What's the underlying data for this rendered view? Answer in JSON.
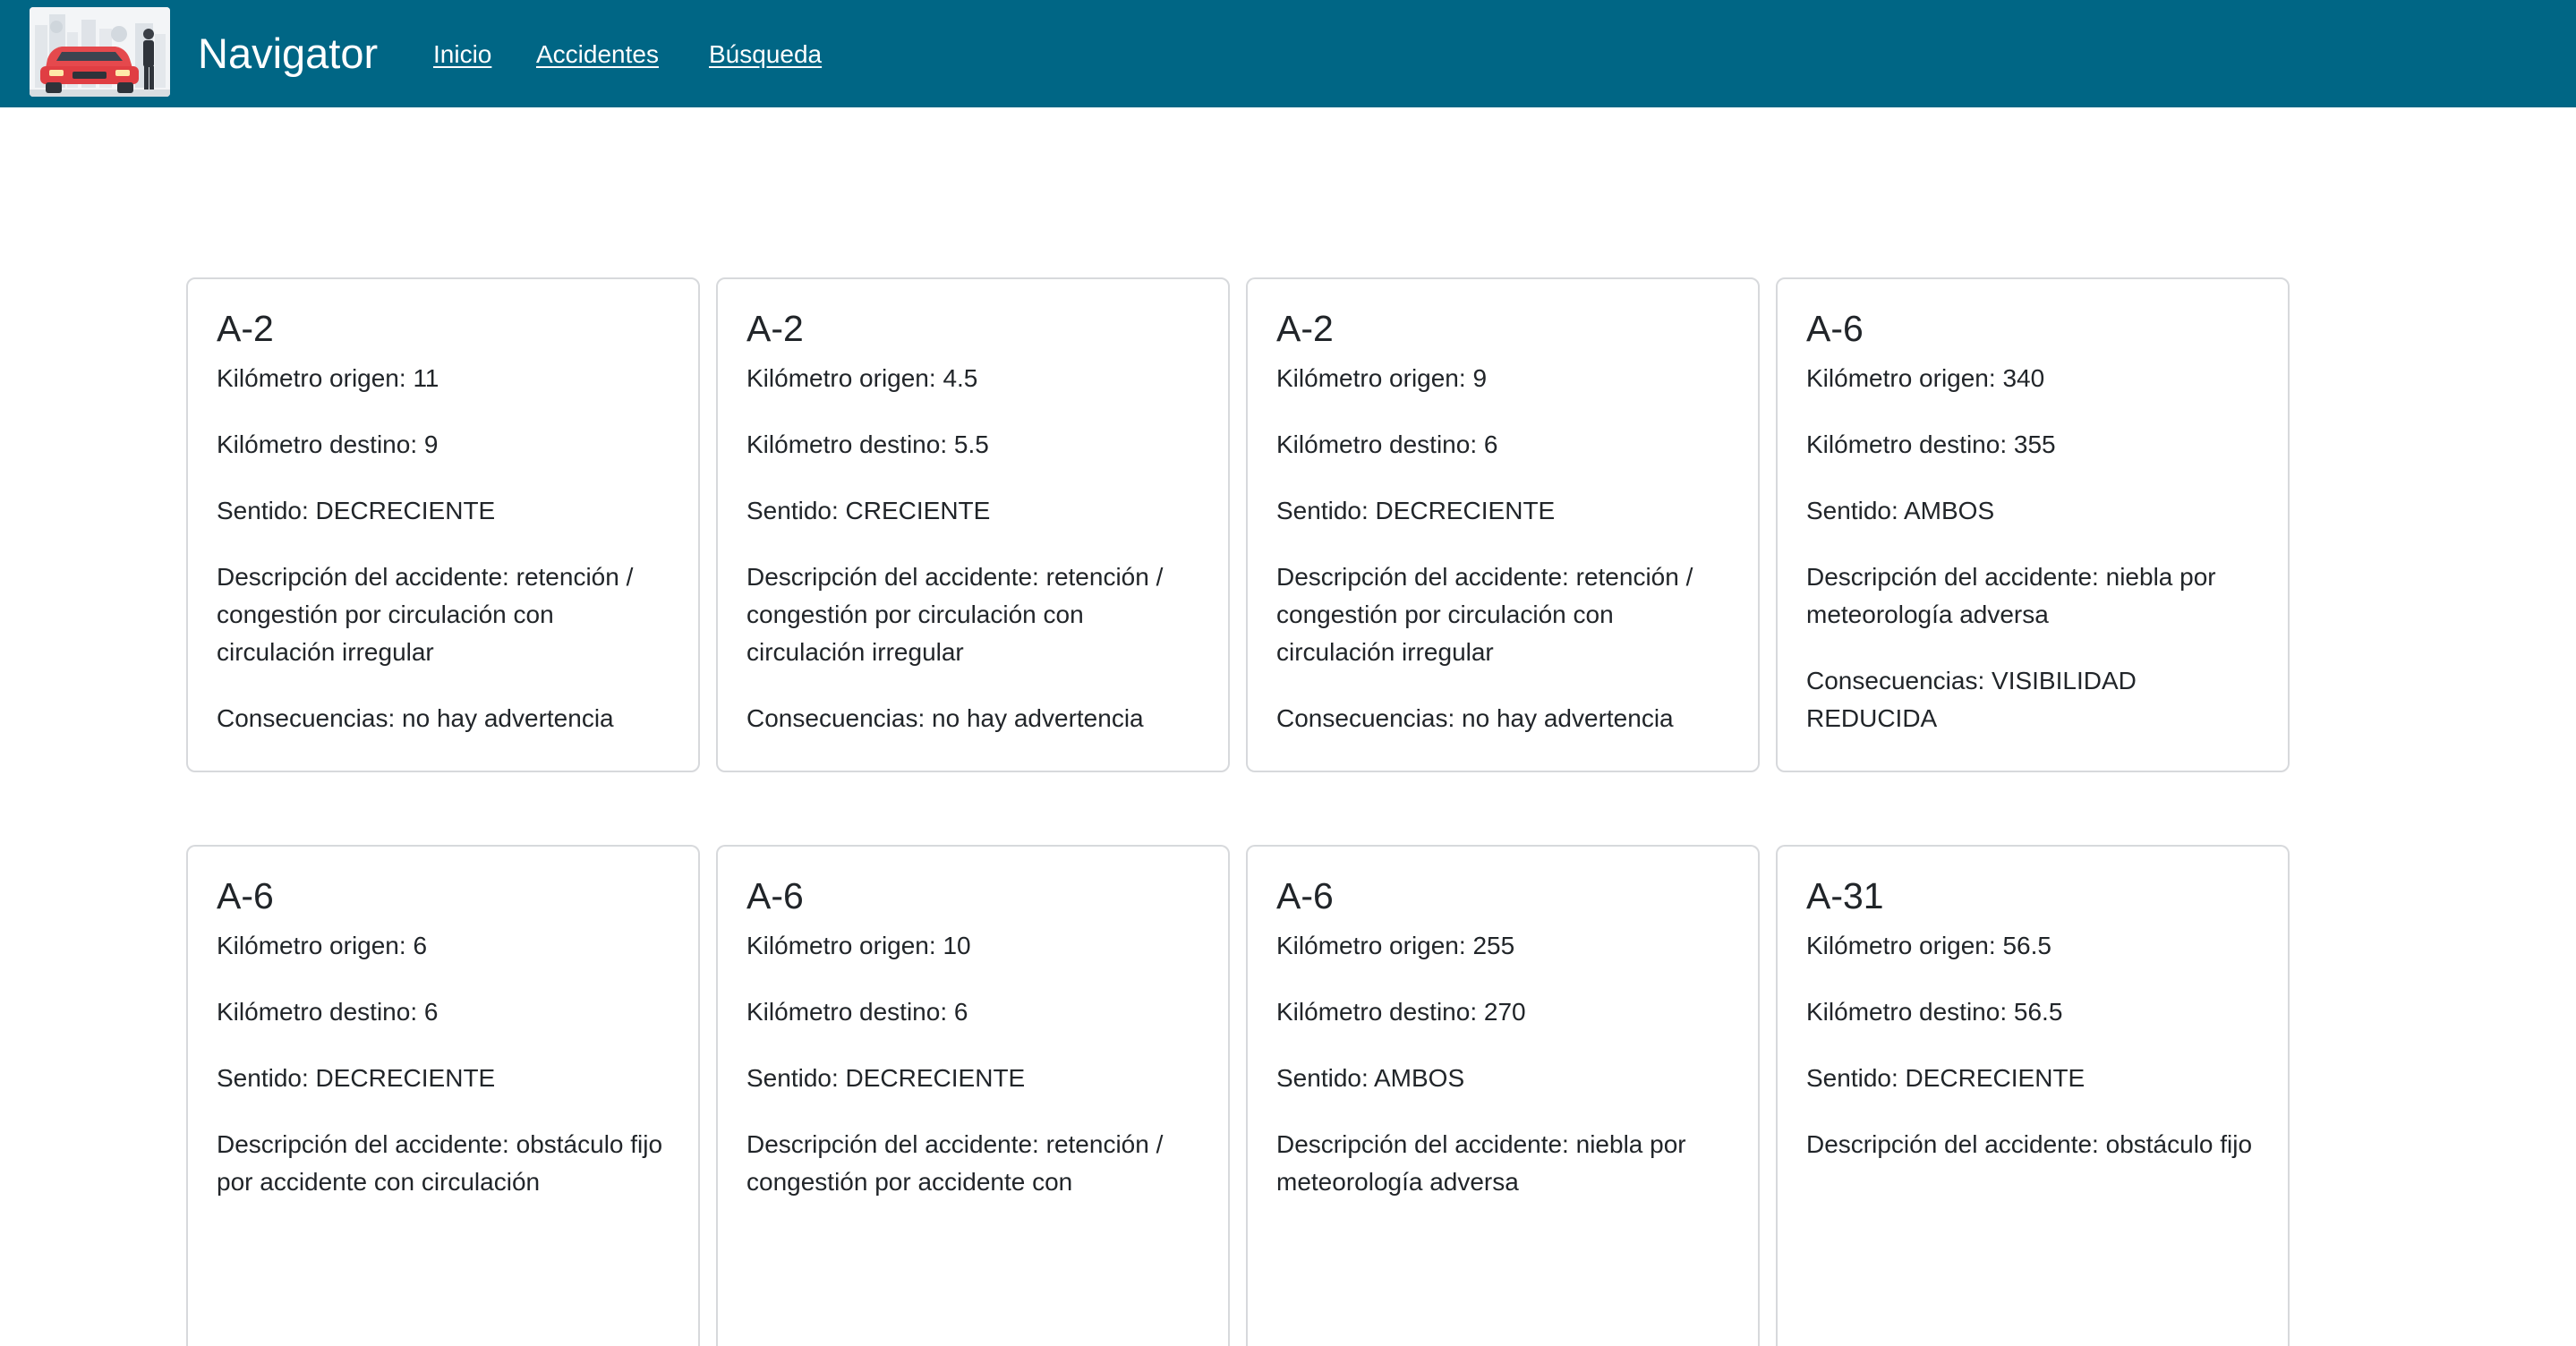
{
  "app": {
    "brand": "Navigator"
  },
  "nav": {
    "items": [
      {
        "label": "Inicio"
      },
      {
        "label": "Accidentes"
      },
      {
        "label": "Búsqueda"
      }
    ]
  },
  "labels": {
    "km_origen": "Kilómetro origen: ",
    "km_destino": "Kilómetro destino: ",
    "sentido": "Sentido: ",
    "descripcion": "Descripción del accidente: ",
    "consecuencias": "Consecuencias: "
  },
  "cards": [
    {
      "road": "A-2",
      "km_origen": "11",
      "km_destino": "9",
      "sentido": "DECRECIENTE",
      "descripcion": "retención / congestión por circulación con circulación irregular",
      "consecuencias": "no hay advertencia"
    },
    {
      "road": "A-2",
      "km_origen": "4.5",
      "km_destino": "5.5",
      "sentido": "CRECIENTE",
      "descripcion": "retención / congestión por circulación con circulación irregular",
      "consecuencias": "no hay advertencia"
    },
    {
      "road": "A-2",
      "km_origen": "9",
      "km_destino": "6",
      "sentido": "DECRECIENTE",
      "descripcion": "retención / congestión por circulación con circulación irregular",
      "consecuencias": "no hay advertencia"
    },
    {
      "road": "A-6",
      "km_origen": "340",
      "km_destino": "355",
      "sentido": "AMBOS",
      "descripcion": "niebla por meteorología adversa",
      "consecuencias": "VISIBILIDAD REDUCIDA"
    },
    {
      "road": "A-6",
      "km_origen": "6",
      "km_destino": "6",
      "sentido": "DECRECIENTE",
      "descripcion": "obstáculo fijo por accidente con circulación"
    },
    {
      "road": "A-6",
      "km_origen": "10",
      "km_destino": "6",
      "sentido": "DECRECIENTE",
      "descripcion": "retención / congestión por accidente con"
    },
    {
      "road": "A-6",
      "km_origen": "255",
      "km_destino": "270",
      "sentido": "AMBOS",
      "descripcion": "niebla por meteorología adversa"
    },
    {
      "road": "A-31",
      "km_origen": "56.5",
      "km_destino": "56.5",
      "sentido": "DECRECIENTE",
      "descripcion": "obstáculo fijo"
    }
  ],
  "colors": {
    "navbar": "#006685",
    "card_border": "#d7d9dc",
    "text": "#212529"
  }
}
